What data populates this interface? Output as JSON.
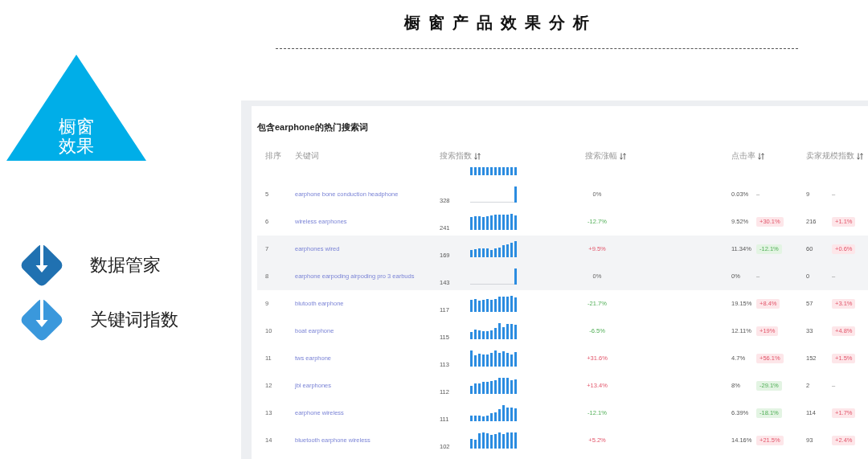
{
  "title": "橱窗产品效果分析",
  "slide": {
    "triangle_label": "橱窗效果",
    "items": [
      {
        "label": "数据管家",
        "color": "#2071b1"
      },
      {
        "label": "关键词指数",
        "color": "#3a98dc"
      }
    ]
  },
  "panel": {
    "title": "包含earphone的热门搜索词",
    "columns": [
      {
        "label": "排序",
        "sortable": false
      },
      {
        "label": "关键词",
        "sortable": false
      },
      {
        "label": "搜索指数",
        "sortable": true
      },
      {
        "label": "搜索涨幅",
        "sortable": true
      },
      {
        "label": "点击率",
        "sortable": true
      },
      {
        "label": "卖家规模指数",
        "sortable": true
      }
    ],
    "clipped_row": {
      "kind": "bars"
    },
    "rows": [
      {
        "rank": "5",
        "keyword": "earphone bone conduction headphone",
        "search_index": "328",
        "kind": "spike",
        "growth": {
          "text": "0%",
          "kind": "flat"
        },
        "click_rate": "0.03%",
        "click_change": {
          "text": "–",
          "kind": "none"
        },
        "seller_index": "9",
        "seller_change": {
          "text": "–",
          "kind": "none"
        },
        "highlighted": false
      },
      {
        "rank": "6",
        "keyword": "wireless earphones",
        "search_index": "241",
        "kind": "bars",
        "growth": {
          "text": "-12.7%",
          "kind": "down"
        },
        "click_rate": "9.52%",
        "click_change": {
          "text": "+30.1%",
          "kind": "up"
        },
        "seller_index": "216",
        "seller_change": {
          "text": "+1.1%",
          "kind": "up"
        },
        "highlighted": false
      },
      {
        "rank": "7",
        "keyword": "earphones wired",
        "search_index": "169",
        "kind": "bars",
        "growth": {
          "text": "+9.5%",
          "kind": "up"
        },
        "click_rate": "11.34%",
        "click_change": {
          "text": "-12.1%",
          "kind": "down"
        },
        "seller_index": "60",
        "seller_change": {
          "text": "+0.6%",
          "kind": "up"
        },
        "highlighted": true
      },
      {
        "rank": "8",
        "keyword": "earphone earpoding airpoding pro 3 earbuds",
        "search_index": "143",
        "kind": "spike",
        "growth": {
          "text": "0%",
          "kind": "flat"
        },
        "click_rate": "0%",
        "click_change": {
          "text": "–",
          "kind": "none"
        },
        "seller_index": "0",
        "seller_change": {
          "text": "–",
          "kind": "none"
        },
        "highlighted": true
      },
      {
        "rank": "9",
        "keyword": "blutooth earphone",
        "search_index": "117",
        "kind": "bars",
        "growth": {
          "text": "-21.7%",
          "kind": "down"
        },
        "click_rate": "19.15%",
        "click_change": {
          "text": "+8.4%",
          "kind": "up"
        },
        "seller_index": "57",
        "seller_change": {
          "text": "+3.1%",
          "kind": "up"
        },
        "highlighted": false
      },
      {
        "rank": "10",
        "keyword": "boat earphone",
        "search_index": "115",
        "kind": "bars",
        "growth": {
          "text": "-6.5%",
          "kind": "down"
        },
        "click_rate": "12.11%",
        "click_change": {
          "text": "+19%",
          "kind": "up"
        },
        "seller_index": "33",
        "seller_change": {
          "text": "+4.8%",
          "kind": "up"
        },
        "highlighted": false
      },
      {
        "rank": "11",
        "keyword": "tws earphone",
        "search_index": "113",
        "kind": "bars",
        "growth": {
          "text": "+31.6%",
          "kind": "up"
        },
        "click_rate": "4.7%",
        "click_change": {
          "text": "+56.1%",
          "kind": "up"
        },
        "seller_index": "152",
        "seller_change": {
          "text": "+1.5%",
          "kind": "up"
        },
        "highlighted": false
      },
      {
        "rank": "12",
        "keyword": "jbl earphones",
        "search_index": "112",
        "kind": "bars",
        "growth": {
          "text": "+13.4%",
          "kind": "up"
        },
        "click_rate": "8%",
        "click_change": {
          "text": "-29.1%",
          "kind": "down"
        },
        "seller_index": "2",
        "seller_change": {
          "text": "–",
          "kind": "none"
        },
        "highlighted": false
      },
      {
        "rank": "13",
        "keyword": "earphone wireless",
        "search_index": "111",
        "kind": "bars",
        "growth": {
          "text": "-12.1%",
          "kind": "down"
        },
        "click_rate": "6.39%",
        "click_change": {
          "text": "-18.1%",
          "kind": "down"
        },
        "seller_index": "114",
        "seller_change": {
          "text": "+1.7%",
          "kind": "up"
        },
        "highlighted": false
      },
      {
        "rank": "14",
        "keyword": "bluetooth earphone wireless",
        "search_index": "102",
        "kind": "bars",
        "growth": {
          "text": "+5.2%",
          "kind": "up"
        },
        "click_rate": "14.16%",
        "click_change": {
          "text": "+21.5%",
          "kind": "up"
        },
        "seller_index": "93",
        "seller_change": {
          "text": "+2.4%",
          "kind": "up"
        },
        "highlighted": false
      }
    ]
  }
}
